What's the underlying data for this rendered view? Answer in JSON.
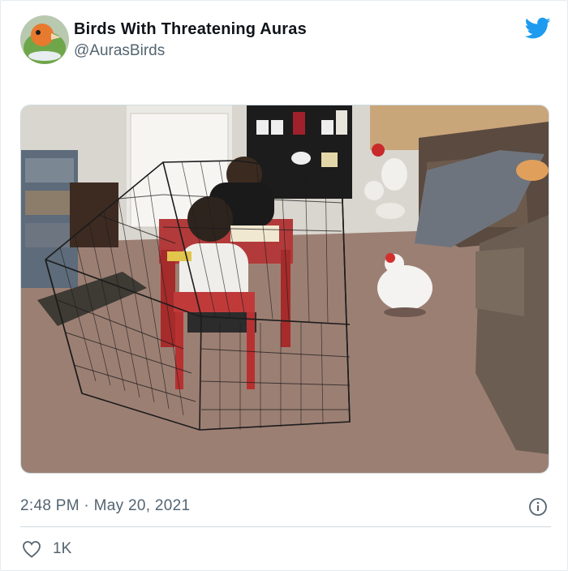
{
  "tweet": {
    "author_name": "Birds With Threatening Auras",
    "handle": "@AurasBirds",
    "timestamp": "2:48 PM · May 20, 2021",
    "like_count": "1K",
    "avatar_icon": "bird-avatar",
    "logo_icon": "twitter-bird-icon",
    "info_icon": "info-icon",
    "like_icon": "heart-outline-icon",
    "media_description_alt": "photo"
  },
  "colors": {
    "twitter_blue": "#1d9bf0",
    "secondary_text": "#536471",
    "primary_text": "#0f1419",
    "divider": "#cfd9de"
  }
}
